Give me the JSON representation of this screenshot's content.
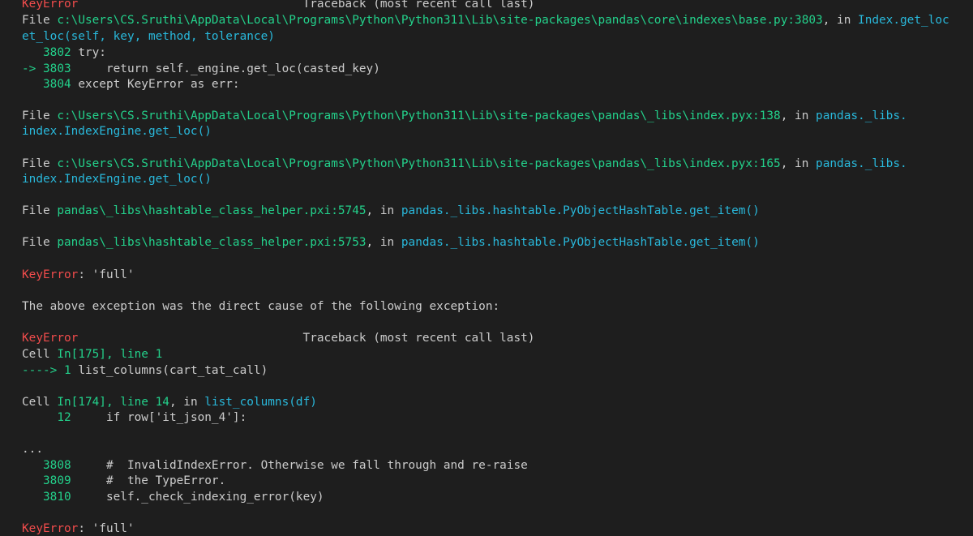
{
  "colors": {
    "background": "#1e1e1e",
    "default": "#cccccc",
    "red": "#f14c4c",
    "green": "#23d18b",
    "cyan": "#29b8db",
    "blue": "#3b8eea"
  },
  "lines": [
    {
      "id": "error-header-1",
      "segments": [
        {
          "t": "KeyError",
          "c": "red"
        },
        {
          "t": "                                Traceback (most recent call last)",
          "c": "default"
        }
      ]
    },
    {
      "id": "file-line-1a",
      "segments": [
        {
          "t": "File ",
          "c": "default"
        },
        {
          "t": "c:\\Users\\CS.Sruthi\\AppData\\Local\\Programs\\Python\\Python311\\Lib\\site-packages\\pandas\\core\\indexes\\base.py:3803",
          "c": "green"
        },
        {
          "t": ", in ",
          "c": "default"
        },
        {
          "t": "Index.get_loc",
          "c": "cyan"
        }
      ]
    },
    {
      "id": "file-line-1b",
      "segments": [
        {
          "t": "et_loc(self, key, method, tolerance)",
          "c": "cyan"
        }
      ]
    },
    {
      "id": "code-3802",
      "segments": [
        {
          "t": "   3802",
          "c": "green"
        },
        {
          "t": " try:",
          "c": "default"
        }
      ]
    },
    {
      "id": "code-3803",
      "segments": [
        {
          "t": "-> 3803",
          "c": "green"
        },
        {
          "t": "     return self._engine.get_loc(casted_key)",
          "c": "default"
        }
      ]
    },
    {
      "id": "code-3804",
      "segments": [
        {
          "t": "   3804",
          "c": "green"
        },
        {
          "t": " except KeyError as err:",
          "c": "default"
        }
      ]
    },
    {
      "id": "file-line-2a",
      "segments": [
        {
          "t": "File ",
          "c": "default"
        },
        {
          "t": "c:\\Users\\CS.Sruthi\\AppData\\Local\\Programs\\Python\\Python311\\Lib\\site-packages\\pandas\\_libs\\index.pyx:138",
          "c": "green"
        },
        {
          "t": ", in ",
          "c": "default"
        },
        {
          "t": "pandas._libs.",
          "c": "cyan"
        }
      ]
    },
    {
      "id": "file-line-2b",
      "segments": [
        {
          "t": "index.IndexEngine.get_loc()",
          "c": "cyan"
        }
      ]
    },
    {
      "id": "file-line-3a",
      "segments": [
        {
          "t": "File ",
          "c": "default"
        },
        {
          "t": "c:\\Users\\CS.Sruthi\\AppData\\Local\\Programs\\Python\\Python311\\Lib\\site-packages\\pandas\\_libs\\index.pyx:165",
          "c": "green"
        },
        {
          "t": ", in ",
          "c": "default"
        },
        {
          "t": "pandas._libs.",
          "c": "cyan"
        }
      ]
    },
    {
      "id": "file-line-3b",
      "segments": [
        {
          "t": "index.IndexEngine.get_loc()",
          "c": "cyan"
        }
      ]
    },
    {
      "id": "file-line-4",
      "segments": [
        {
          "t": "File ",
          "c": "default"
        },
        {
          "t": "pandas\\_libs\\hashtable_class_helper.pxi:5745",
          "c": "green"
        },
        {
          "t": ", in ",
          "c": "default"
        },
        {
          "t": "pandas._libs.hashtable.PyObjectHashTable.get_item()",
          "c": "cyan"
        }
      ]
    },
    {
      "id": "file-line-5",
      "segments": [
        {
          "t": "File ",
          "c": "default"
        },
        {
          "t": "pandas\\_libs\\hashtable_class_helper.pxi:5753",
          "c": "green"
        },
        {
          "t": ", in ",
          "c": "default"
        },
        {
          "t": "pandas._libs.hashtable.PyObjectHashTable.get_item()",
          "c": "cyan"
        }
      ]
    },
    {
      "id": "key-error-1",
      "segments": [
        {
          "t": "KeyError",
          "c": "red"
        },
        {
          "t": ": 'full'",
          "c": "default"
        }
      ]
    },
    {
      "id": "cause-message",
      "segments": [
        {
          "t": "The above exception was the direct cause of the following exception:",
          "c": "default"
        }
      ]
    },
    {
      "id": "error-header-2",
      "segments": [
        {
          "t": "KeyError",
          "c": "red"
        },
        {
          "t": "                                Traceback (most recent call last)",
          "c": "default"
        }
      ]
    },
    {
      "id": "cell-line-1",
      "segments": [
        {
          "t": "Cell ",
          "c": "default"
        },
        {
          "t": "In[175], line 1",
          "c": "green"
        }
      ]
    },
    {
      "id": "code-cell-1",
      "segments": [
        {
          "t": "----> 1",
          "c": "green"
        },
        {
          "t": " list_columns(cart_tat_call)",
          "c": "default"
        }
      ]
    },
    {
      "id": "cell-line-2",
      "segments": [
        {
          "t": "Cell ",
          "c": "default"
        },
        {
          "t": "In[174], line 14",
          "c": "green"
        },
        {
          "t": ", in ",
          "c": "default"
        },
        {
          "t": "list_columns(df)",
          "c": "cyan"
        }
      ]
    },
    {
      "id": "code-12",
      "segments": [
        {
          "t": "     12",
          "c": "green"
        },
        {
          "t": "     if row['it_json_4']:",
          "c": "default"
        }
      ]
    },
    {
      "id": "ellipsis",
      "segments": [
        {
          "t": "...",
          "c": "default"
        }
      ]
    },
    {
      "id": "code-3808",
      "segments": [
        {
          "t": "   3808",
          "c": "green"
        },
        {
          "t": "     #  InvalidIndexError. Otherwise we fall through and re-raise",
          "c": "default"
        }
      ]
    },
    {
      "id": "code-3809",
      "segments": [
        {
          "t": "   3809",
          "c": "green"
        },
        {
          "t": "     #  the TypeError.",
          "c": "default"
        }
      ]
    },
    {
      "id": "code-3810",
      "segments": [
        {
          "t": "   3810",
          "c": "green"
        },
        {
          "t": "     self._check_indexing_error(key)",
          "c": "default"
        }
      ]
    },
    {
      "id": "key-error-2",
      "segments": [
        {
          "t": "KeyError",
          "c": "red"
        },
        {
          "t": ": 'full'",
          "c": "default"
        }
      ]
    }
  ]
}
